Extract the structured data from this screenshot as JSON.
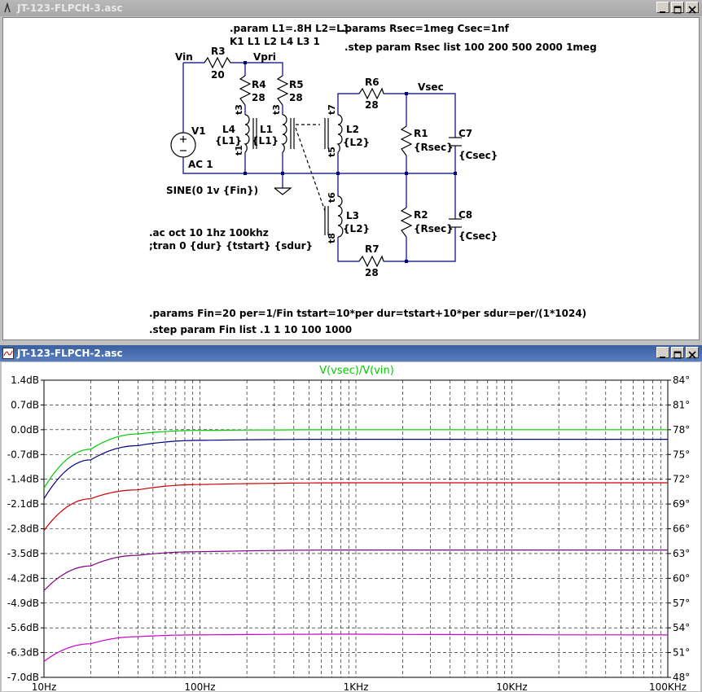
{
  "windows": {
    "schematic": {
      "title": "JT-123-FLPCH-3.asc"
    },
    "plot": {
      "title": "JT-123-FLPCH-2.asc"
    }
  },
  "schematic": {
    "directives": {
      "param_l": ".param L1=.8H L2=L1",
      "couple": "K1 L1 L2 L4  L3 1",
      "params_rsec": ".params Rsec=1meg Csec=1nf",
      "step_rsec": ".step param Rsec list 100 200 500 2000 1meg",
      "ac": ".ac oct 10 1hz 100khz",
      "tran": ";tran 0 {dur} {tstart} {sdur}",
      "params_fin": ".params Fin=20 per=1/Fin tstart=10*per dur=tstart+10*per sdur=per/(1*1024)",
      "step_fin": ".step param Fin list .1 1 10 100 1000"
    },
    "labels": {
      "vin": "Vin",
      "vpri": "Vpri",
      "vsec": "Vsec",
      "r3": "R3",
      "r3v": "20",
      "r4": "R4",
      "r4v": "28",
      "r5": "R5",
      "r5v": "28",
      "r6": "R6",
      "r6v": "28",
      "r7": "R7",
      "r7v": "28",
      "r1": "R1",
      "r1v": "{Rsec}",
      "r2": "R2",
      "r2v": "{Rsec}",
      "c7": "C7",
      "c7v": "{Csec}",
      "c8": "C8",
      "c8v": "{Csec}",
      "v1": "V1",
      "v1ac": "AC 1",
      "v1sine": "SINE(0 1v {Fin})",
      "l4": "L4",
      "l4v": "{L1}",
      "l1": "L1",
      "l1v": "{L1}",
      "l2": "L2",
      "l2v": "{L2}",
      "l3": "L3",
      "l3v": "{L2}",
      "t1": "t1",
      "t3a": "t3",
      "t3b": "t3",
      "t7": "t7",
      "t5": "t5",
      "t6": "t6",
      "t8": "t8"
    }
  },
  "chart_data": {
    "type": "line",
    "title": "V(vsec)/V(vin)",
    "x_scale": "log",
    "x_ticks": [
      "10Hz",
      "100Hz",
      "1KHz",
      "10KHz",
      "100KHz"
    ],
    "xlim": [
      10,
      100000
    ],
    "y_left_ticks": [
      "1.4dB",
      "0.7dB",
      "0.0dB",
      "-0.7dB",
      "-1.4dB",
      "-2.1dB",
      "-2.8dB",
      "-3.5dB",
      "-4.2dB",
      "-4.9dB",
      "-5.6dB",
      "-6.3dB",
      "-7.0dB"
    ],
    "y_right_ticks": [
      "84°",
      "81°",
      "78°",
      "75°",
      "72°",
      "69°",
      "66°",
      "63°",
      "60°",
      "57°",
      "54°",
      "51°",
      "48°"
    ],
    "ylim": [
      -7.0,
      1.4
    ],
    "grid": true,
    "series": [
      {
        "color": "#00cc00",
        "x": [
          10,
          20,
          40,
          100,
          1000,
          100000
        ],
        "y": [
          -1.65,
          -0.55,
          -0.12,
          -0.02,
          0.0,
          0.0
        ]
      },
      {
        "color": "#000080",
        "x": [
          10,
          20,
          40,
          100,
          1000,
          100000
        ],
        "y": [
          -1.95,
          -0.85,
          -0.45,
          -0.3,
          -0.27,
          -0.27
        ]
      },
      {
        "color": "#cc0000",
        "x": [
          10,
          20,
          40,
          100,
          1000,
          100000
        ],
        "y": [
          -2.85,
          -1.95,
          -1.7,
          -1.55,
          -1.5,
          -1.5
        ]
      },
      {
        "color": "#800080",
        "x": [
          10,
          20,
          40,
          100,
          1000,
          100000
        ],
        "y": [
          -4.55,
          -3.85,
          -3.55,
          -3.45,
          -3.4,
          -3.4
        ]
      },
      {
        "color": "#cc00cc",
        "x": [
          10,
          20,
          40,
          100,
          1000,
          100000
        ],
        "y": [
          -6.55,
          -6.05,
          -5.85,
          -5.8,
          -5.78,
          -5.8
        ]
      }
    ]
  }
}
